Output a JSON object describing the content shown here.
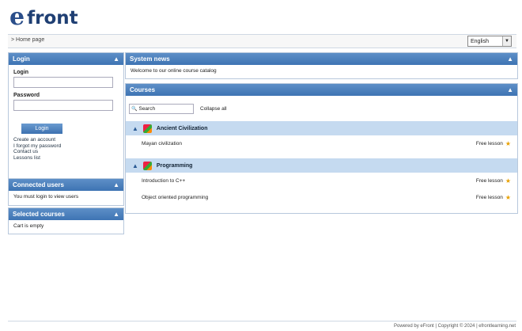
{
  "brand": {
    "logo_letter": "e",
    "logo_text": "front"
  },
  "topbar": {
    "home_label": "> Home page",
    "language": "English"
  },
  "login": {
    "title": "Login",
    "login_label": "Login",
    "password_label": "Password",
    "button_label": "Login",
    "links": [
      "Create an account",
      "I forgot my password",
      "Contact us",
      "Lessons list"
    ]
  },
  "connected": {
    "title": "Connected users",
    "text": "You must login to view users"
  },
  "selected": {
    "title": "Selected courses",
    "text": "Cart is empty"
  },
  "news": {
    "title": "System news",
    "text": "Welcome to our online course catalog"
  },
  "courses": {
    "title": "Courses",
    "search_placeholder": "Search",
    "collapse_all": "Collapse all",
    "categories": [
      {
        "name": "Ancient Civilization",
        "items": [
          {
            "name": "Mayan civilization",
            "price": "Free lesson"
          }
        ]
      },
      {
        "name": "Programming",
        "items": [
          {
            "name": "Introduction to C++",
            "price": "Free lesson"
          },
          {
            "name": "Object oriented programming",
            "price": "Free lesson"
          }
        ]
      }
    ]
  },
  "footer": {
    "text": "Powered by eFront | Copyright © 2024 | efrontlearning.net"
  }
}
